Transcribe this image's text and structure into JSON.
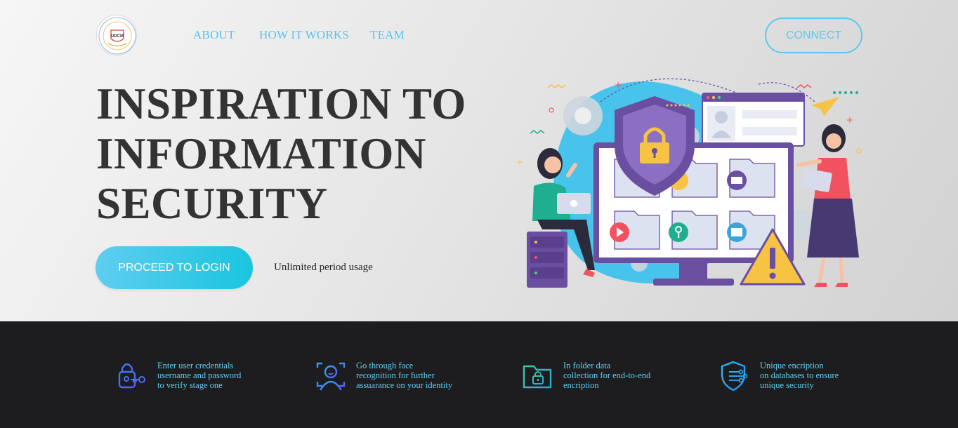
{
  "header": {
    "logo_text": "UDCM",
    "nav": [
      {
        "label": "ABOUT"
      },
      {
        "label": "HOW IT WORKS"
      },
      {
        "label": "TEAM"
      }
    ],
    "connect_label": "CONNECT"
  },
  "hero": {
    "headline_lines": [
      "INSPIRATION TO",
      "INFORMATION",
      "SECURITY"
    ],
    "login_label": "PROCEED TO LOGIN",
    "usage_text": "Unlimited period usage"
  },
  "features": [
    {
      "icon": "lock-key-icon",
      "text": "Enter user credentials\nusername and password\nto verify stage one"
    },
    {
      "icon": "face-scan-icon",
      "text": "Go through face\nrecognition for further\nassuarance on your identity"
    },
    {
      "icon": "folder-lock-icon",
      "text": "In folder data\ncollection for end-to-end\nencription"
    },
    {
      "icon": "shield-circuit-icon",
      "text": "Unique encription\non databases to ensure\nunique security"
    }
  ],
  "colors": {
    "accent": "#52c5ec",
    "headline": "#333333",
    "footer_bg": "#1d1d1f",
    "feature_text": "#5ecff2"
  }
}
